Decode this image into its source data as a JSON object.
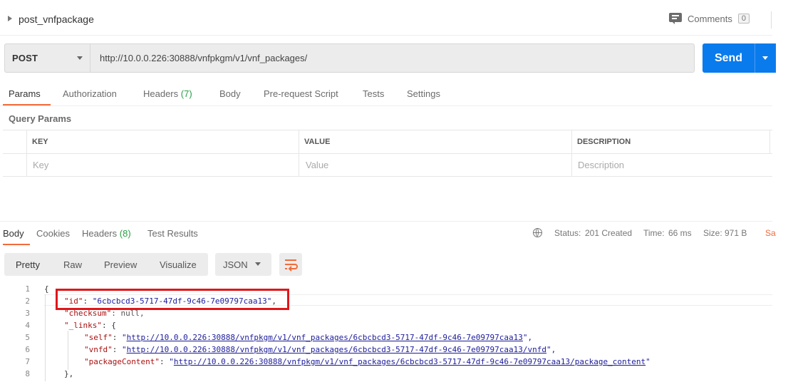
{
  "request": {
    "name": "post_vnfpackage",
    "comments_label": "Comments",
    "comments_count": "0",
    "method": "POST",
    "url": "http://10.0.0.226:30888/vnfpkgm/v1/vnf_packages/",
    "send_label": "Send"
  },
  "request_tabs": {
    "params": "Params",
    "authorization": "Authorization",
    "headers": "Headers",
    "headers_count": "(7)",
    "body": "Body",
    "prerequest": "Pre-request Script",
    "tests": "Tests",
    "settings": "Settings"
  },
  "query_params": {
    "label": "Query Params",
    "headers": {
      "key": "KEY",
      "value": "VALUE",
      "description": "DESCRIPTION"
    },
    "placeholders": {
      "key": "Key",
      "value": "Value",
      "description": "Description"
    }
  },
  "response_tabs": {
    "body": "Body",
    "cookies": "Cookies",
    "headers": "Headers",
    "headers_count": "(8)",
    "test_results": "Test Results"
  },
  "response_status": {
    "status_label": "Status:",
    "status_value": "201 Created",
    "time_label": "Time:",
    "time_value": "66 ms",
    "size_label": "Size:",
    "size_value": "971 B",
    "save_partial": "Sa"
  },
  "view_toolbar": {
    "pretty": "Pretty",
    "raw": "Raw",
    "preview": "Preview",
    "visualize": "Visualize",
    "format": "JSON"
  },
  "code": {
    "line_numbers": [
      "1",
      "2",
      "3",
      "4",
      "5",
      "6",
      "7",
      "8"
    ],
    "lines": {
      "l1": "{",
      "l2_key": "\"id\"",
      "l2_colon": ": ",
      "l2_val": "\"6cbcbcd3-5717-47df-9c46-7e09797caa13\"",
      "l2_comma": ",",
      "l3_key": "\"checksum\"",
      "l3_rest": ": null,",
      "l4_key": "\"_links\"",
      "l4_rest": ": {",
      "l5_key": "\"self\"",
      "l5_colon": ": ",
      "l5_q1": "\"",
      "l5_url": "http://10.0.0.226:30888/vnfpkgm/v1/vnf_packages/6cbcbcd3-5717-47df-9c46-7e09797caa13",
      "l5_end": "\",",
      "l6_key": "\"vnfd\"",
      "l6_colon": ": ",
      "l6_q1": "\"",
      "l6_url": "http://10.0.0.226:30888/vnfpkgm/v1/vnf_packages/6cbcbcd3-5717-47df-9c46-7e09797caa13/vnfd",
      "l6_end": "\",",
      "l7_key": "\"packageContent\"",
      "l7_colon": ": ",
      "l7_q1": "\"",
      "l7_url": "http://10.0.0.226:30888/vnfpkgm/v1/vnf_packages/6cbcbcd3-5717-47df-9c46-7e09797caa13/package_content",
      "l7_end": "\"",
      "l8": "},"
    }
  },
  "colors": {
    "accent_orange": "#f26b3a",
    "send_blue": "#097bed",
    "status_green": "#26a045",
    "highlight_red": "#e0161a"
  },
  "icons": [
    "caret-right-icon",
    "comments-icon",
    "chevron-down-icon",
    "globe-icon",
    "wrap-lines-icon"
  ]
}
